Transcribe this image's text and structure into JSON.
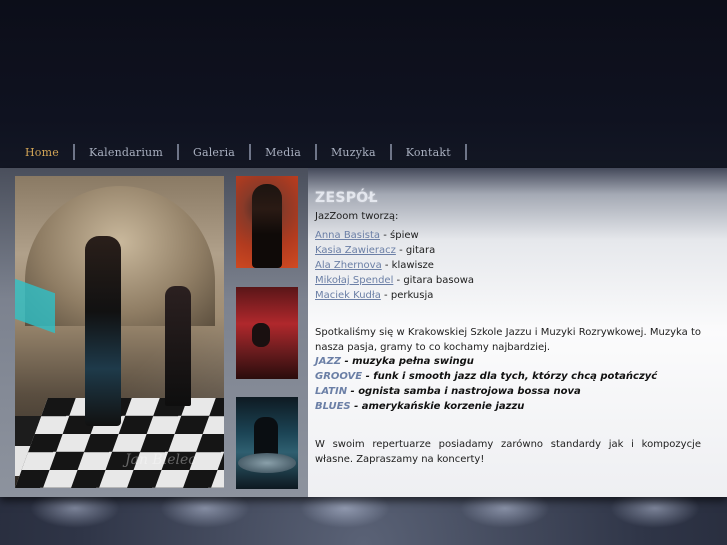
{
  "nav": {
    "items": [
      {
        "label": "Home",
        "active": true
      },
      {
        "label": "Kalendarium",
        "active": false
      },
      {
        "label": "Galeria",
        "active": false
      },
      {
        "label": "Media",
        "active": false
      },
      {
        "label": "Muzyka",
        "active": false
      },
      {
        "label": "Kontakt",
        "active": false
      }
    ]
  },
  "photos": {
    "main_watermark": "Jan Bielec"
  },
  "content": {
    "title": "ZESPÓŁ",
    "intro": "JazZoom tworzą:",
    "members": [
      {
        "name": "Anna Basista",
        "role": " - śpiew"
      },
      {
        "name": "Kasia Zawieracz",
        "role": " - gitara"
      },
      {
        "name": "Ala Zhernova",
        "role": " - klawisze"
      },
      {
        "name": "Mikołaj Spendel",
        "role": " - gitara basowa"
      },
      {
        "name": "Maciek Kudła",
        "role": " - perkusja"
      }
    ],
    "paragraph1": "Spotkaliśmy się w Krakowskiej Szkole Jazzu i Muzyki Rozrywkowej. Muzyka to nasza pasja, gramy to co kochamy najbardziej.",
    "genres": [
      {
        "name": "JAZZ",
        "desc": " - muzyka pełna swingu"
      },
      {
        "name": "GROOVE",
        "desc": " - funk i smooth jazz dla tych, którzy chcą potańczyć"
      },
      {
        "name": "LATIN",
        "desc": " - ognista samba i nastrojowa bossa nova"
      },
      {
        "name": "BLUES",
        "desc": " - amerykańskie korzenie jazzu"
      }
    ],
    "paragraph2": "W swoim repertuarze posiadamy zarówno standardy jak i kompozycje własne. Zapraszamy na koncerty!"
  },
  "colors": {
    "nav_active": "#d1a456",
    "link": "#6b7fa6"
  }
}
